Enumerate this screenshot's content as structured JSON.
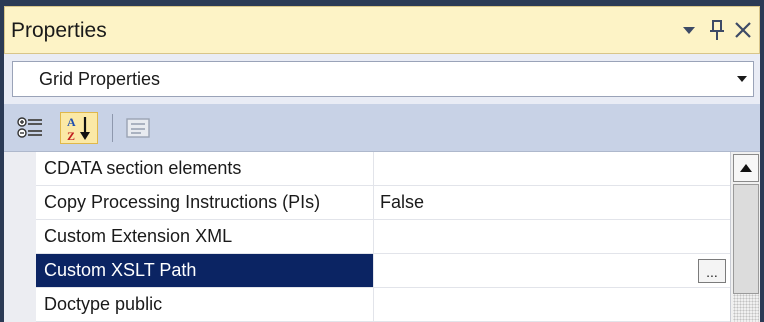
{
  "window": {
    "title": "Properties"
  },
  "object_selector": {
    "value": "Grid Properties"
  },
  "toolbar": {
    "buttons": [
      {
        "icon": "categorized-icon",
        "selected": false
      },
      {
        "icon": "alphabetical-sort-icon",
        "selected": true
      },
      {
        "icon": "property-pages-icon",
        "selected": false,
        "enabled": false
      }
    ]
  },
  "properties": [
    {
      "name": "CDATA section elements",
      "value": ""
    },
    {
      "name": "Copy Processing Instructions (PIs)",
      "value": "False"
    },
    {
      "name": "Custom Extension XML",
      "value": ""
    },
    {
      "name": "Custom XSLT Path",
      "value": "",
      "selected": true,
      "ellipsis": "..."
    },
    {
      "name": "Doctype public",
      "value": ""
    }
  ],
  "colors": {
    "title_bg": "#fdf3c6",
    "toolbar_bg": "#c8d2e6",
    "selection": "#0b2463",
    "frame": "#2b3a55"
  }
}
